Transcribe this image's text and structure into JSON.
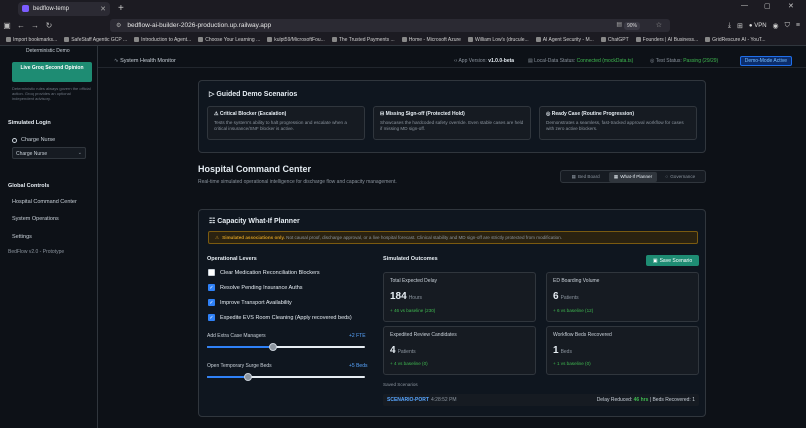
{
  "browser": {
    "tab_title": "bedflow-temp",
    "url": "bedflow-ai-builder-2026-production.up.railway.app",
    "zoom": "90%",
    "vpn_label": "VPN",
    "bookmarks": [
      "Import bookmarks...",
      "SafeStaff Agentic GCP ...",
      "Introduction to Agent...",
      "Choose Your Learning ...",
      "kulpt59/MicrosoftFou...",
      "The Trusted Payments ...",
      "Home - Microsoft Azure",
      "William Low's (drucule...",
      "AI Agent Security - M...",
      "ChatGPT",
      "Founders | AI Business...",
      "GridRescure AI - YouT..."
    ]
  },
  "sidebar": {
    "card_title": "Deterministic Demo",
    "groq_button": "Live Groq Second Opinion",
    "note": "Deterministic rules always govern the official action. Groq provides an optional independent advisory.",
    "login_heading": "Simulated Login",
    "role_option": "Charge Nurse",
    "role_select": "Charge Nurse",
    "controls_heading": "Global Controls",
    "links": [
      "Hospital Command Center",
      "System Operations",
      "Settings"
    ],
    "footer": "BedFlow v2.0 - Prototype"
  },
  "header": {
    "monitor": "System Health Monitor",
    "app_version_label": "App Version:",
    "app_version": "v1.0.0-beta",
    "local_data_label": "Local-Data Status:",
    "local_data_status": "Connected (mockData.ts)",
    "test_label": "Test Status:",
    "test_status": "Passing (29/29)",
    "mode_badge": "Demo-Mode Active"
  },
  "guided": {
    "title": "Guided Demo Scenarios",
    "scenarios": [
      {
        "title": "Critical Blocker (Escalation)",
        "desc": "Tests the system's ability to halt progression and escalate when a critical insurance/SNF blocker is active."
      },
      {
        "title": "Missing Sign-off (Protected Hold)",
        "desc": "Showcases the hardcoded safety override. Even stable cases are held if missing MD sign-off."
      },
      {
        "title": "Ready Case (Routine Progression)",
        "desc": "Demonstrates a seamless, fast-tracked approval workflow for cases with zero active blockers."
      }
    ]
  },
  "hospital": {
    "title": "Hospital Command Center",
    "subtitle": "Real-time simulated operational intelligence for discharge flow and capacity management.",
    "views": [
      "Bed Board",
      "What-If Planner",
      "Governance"
    ],
    "active_view": "What-If Planner"
  },
  "planner": {
    "title": "Capacity What-If Planner",
    "warning_strong": "Simulated associations only.",
    "warning_text": "Not causal proof, discharge approval, or a live hospital forecast. Clinical stability and MD sign-off are strictly protected from modification.",
    "levers_heading": "Operational Levers",
    "levers": [
      {
        "label": "Clear Medication Reconciliation Blockers",
        "checked": false
      },
      {
        "label": "Resolve Pending Insurance Auths",
        "checked": true
      },
      {
        "label": "Improve Transport Availability",
        "checked": true
      },
      {
        "label": "Expedite EVS Room Cleaning (Apply recovered beds)",
        "checked": true
      }
    ],
    "sliders": [
      {
        "label": "Add Extra Case Managers",
        "value_label": "+2 FTE",
        "fraction": 0.42
      },
      {
        "label": "Open Temporary Surge Beds",
        "value_label": "+5 Beds",
        "fraction": 0.26
      }
    ],
    "outcomes_heading": "Simulated Outcomes",
    "save_button": "Save Scenario",
    "cards": [
      {
        "title": "Total Expected Delay",
        "value": "184",
        "unit": "Hours",
        "delta": "+ 46 vs baseline (230)"
      },
      {
        "title": "ED Boarding Volume",
        "value": "6",
        "unit": "Patients",
        "delta": "+ 6 vs baseline (12)"
      },
      {
        "title": "Expedited Review Candidates",
        "value": "4",
        "unit": "Patients",
        "delta": "+ 4 vs baseline (0)"
      },
      {
        "title": "Workflow Beds Recovered",
        "value": "1",
        "unit": "Beds",
        "delta": "+ 1 vs baseline (0)"
      }
    ],
    "saved_heading": "Saved Scenarios",
    "saved": {
      "name": "SCENARIO-PORT",
      "time": "4:28:52 PM",
      "delay_label": "Delay Reduced:",
      "delay_value": "46 hrs",
      "beds_label": "| Beds Recovered: 1"
    }
  }
}
